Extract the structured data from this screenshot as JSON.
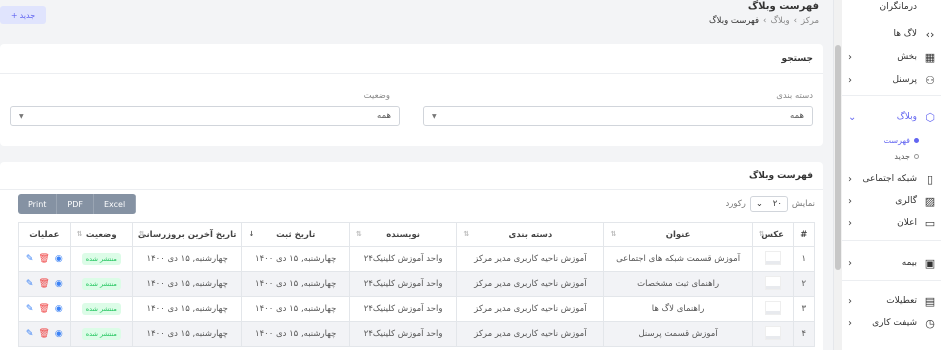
{
  "header": {
    "title": "فهرست وبلاگ",
    "breadcrumb": [
      "مرکز",
      "وبلاگ",
      "فهرست وبلاگ"
    ],
    "new_button": "جدید"
  },
  "sidebar": {
    "top_item": "درمانگران",
    "items": [
      {
        "label": "لاگ ها",
        "icon": "code-icon"
      },
      {
        "label": "بخش",
        "icon": "grid-icon"
      },
      {
        "label": "پرسنل",
        "icon": "user-icon"
      },
      {
        "label": "وبلاگ",
        "icon": "cube-icon",
        "active": true
      },
      {
        "label": "شبکه اجتماعی",
        "icon": "phone-icon"
      },
      {
        "label": "گالری",
        "icon": "image-icon"
      },
      {
        "label": "اعلان",
        "icon": "chat-icon"
      },
      {
        "label": "بیمه",
        "icon": "wallet-icon"
      },
      {
        "label": "تعطیلات",
        "icon": "calendar-icon"
      },
      {
        "label": "شیفت کاری",
        "icon": "clock-icon"
      }
    ],
    "sub_items": [
      {
        "label": "فهرست",
        "active": true
      },
      {
        "label": "جدید",
        "active": false
      }
    ]
  },
  "search_card": {
    "title": "جستجو",
    "category_label": "دسته بندی",
    "category_value": "همه",
    "status_label": "وضعیت",
    "status_value": "همه"
  },
  "list_card": {
    "title": "فهرست وبلاگ",
    "show_label": "نمایش",
    "page_length": "۲۰",
    "records_label": "رکورد",
    "export_buttons": [
      "Print",
      "PDF",
      "Excel"
    ],
    "columns": [
      "#",
      "عکس",
      "عنوان",
      "دسته بندی",
      "نویسنده",
      "تاریخ ثبت",
      "تاریخ آخرین بروزرسانی",
      "وضعیت",
      "عملیات"
    ],
    "rows": [
      {
        "num": "۱",
        "title": "آموزش قسمت شبکه های اجتماعی",
        "category": "آموزش ناحیه کاربری مدیر مرکز",
        "author": "واحد آموزش کلینیک۲۴",
        "created": "چهارشنبه, ۱۵ دی ۱۴۰۰",
        "updated": "چهارشنبه, ۱۵ دی ۱۴۰۰",
        "status": "منتشر شده"
      },
      {
        "num": "۲",
        "title": "راهنمای ثبت مشخصات",
        "category": "آموزش ناحیه کاربری مدیر مرکز",
        "author": "واحد آموزش کلینیک۲۴",
        "created": "چهارشنبه, ۱۵ دی ۱۴۰۰",
        "updated": "چهارشنبه, ۱۵ دی ۱۴۰۰",
        "status": "منتشر شده"
      },
      {
        "num": "۳",
        "title": "راهنمای لاگ ها",
        "category": "آموزش ناحیه کاربری مدیر مرکز",
        "author": "واحد آموزش کلینیک۲۴",
        "created": "چهارشنبه, ۱۵ دی ۱۴۰۰",
        "updated": "چهارشنبه, ۱۵ دی ۱۴۰۰",
        "status": "منتشر شده"
      },
      {
        "num": "۴",
        "title": "آموزش قسمت پرسنل",
        "category": "آموزش ناحیه کاربری مدیر مرکز",
        "author": "واحد آموزش کلینیک۲۴",
        "created": "چهارشنبه, ۱۵ دی ۱۴۰۰",
        "updated": "چهارشنبه, ۱۵ دی ۱۴۰۰",
        "status": "منتشر شده"
      }
    ]
  }
}
